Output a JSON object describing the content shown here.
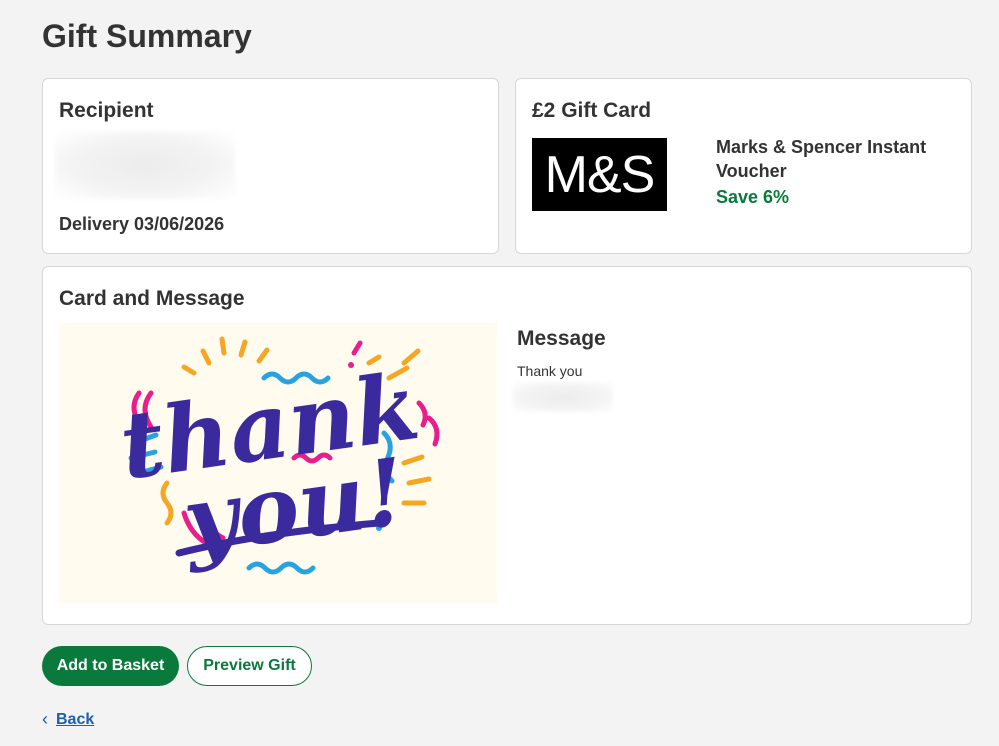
{
  "page": {
    "title": "Gift Summary"
  },
  "recipient": {
    "heading": "Recipient",
    "delivery": "Delivery 03/06/2026"
  },
  "gift_card": {
    "heading": "£2 Gift Card",
    "logo_text": "M&S",
    "product_name": "Marks & Spencer Instant Voucher",
    "saving": "Save 6%"
  },
  "card_message": {
    "heading": "Card and Message",
    "image_alt": "Thank you",
    "message_heading": "Message",
    "message_text": "Thank you"
  },
  "actions": {
    "add_to_basket": "Add to Basket",
    "preview_gift": "Preview Gift",
    "back": "Back"
  },
  "colors": {
    "brand_green": "#0a7a3c",
    "link_blue": "#1a5fb4",
    "page_bg": "#f3f3f3"
  },
  "icons": {
    "back": "chevron-left-icon"
  }
}
